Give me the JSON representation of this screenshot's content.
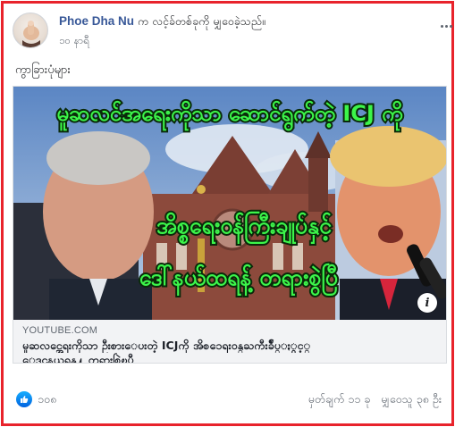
{
  "post": {
    "author_name": "Phoe Dha Nu",
    "action_text": "က လင့်ခ်တစ်ခုကို မျှဝေခဲ့သည်။",
    "timestamp": "၁၀ နာရီ",
    "caption": "ကွာခြားပုံများ"
  },
  "link_preview": {
    "headline_top": "မူဆလင်အရေးကိုသာ ဆောင်ရွက်တဲ့ ICJ ကို",
    "headline_mid": "အိစ္စရေးဝန်ကြီးချုပ်နှင့်",
    "headline_bottom": "ဒေါ်နယ်ထရန့် တရားစွဲပြီ",
    "domain": "YOUTUBE.COM",
    "title_line1": "မူဆလင္အေရးကိုသာ ဦးစားေပးတဲ့ ICJကို အိစၥေရးဝန္ႀကီးခ်ဳပ္ႏွင့္",
    "title_line2": "ေဒၚနယ္ထရန္႔ တရားစြဲၿပီ",
    "info_label": "i"
  },
  "footer": {
    "like_count": "၁၀၈",
    "comments": "မှတ်ချက် ၁၁ ခု",
    "shares": "မျှဝေသူ ၃၈ ဦး"
  },
  "colors": {
    "frame_border": "#e8232b",
    "author_link": "#385898",
    "headline_green": "#3cf54a",
    "like_blue": "#1877f2"
  },
  "icons": {
    "more": "more-options-icon",
    "info": "info-icon",
    "like": "like-thumb-icon"
  }
}
